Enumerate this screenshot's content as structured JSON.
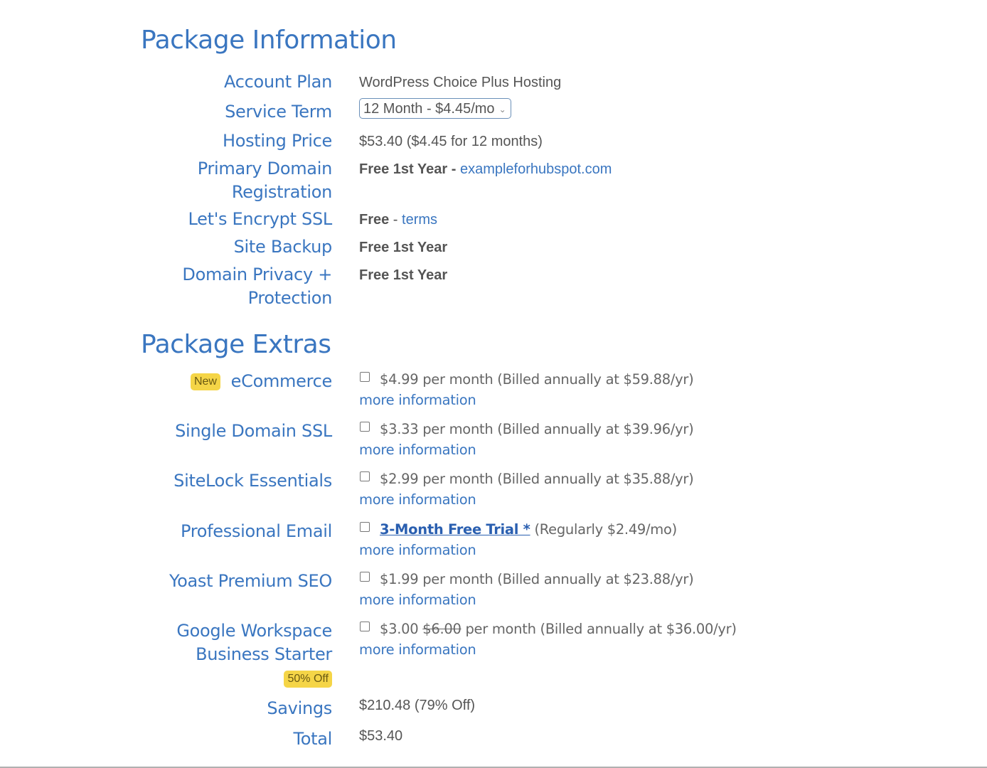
{
  "package_information": {
    "title": "Package Information",
    "rows": {
      "account_plan": {
        "label": "Account Plan",
        "value": "WordPress Choice Plus Hosting"
      },
      "service_term": {
        "label": "Service Term",
        "selected": "12 Month - $4.45/mo",
        "icon": "chevron-down-icon"
      },
      "hosting_price": {
        "label": "Hosting Price",
        "value": "$53.40 ($4.45 for 12 months)"
      },
      "primary_domain": {
        "label_line1": "Primary Domain",
        "label_line2": "Registration",
        "value_bold": "Free 1st Year -",
        "link": "exampleforhubspot.com"
      },
      "ssl": {
        "label": "Let's Encrypt SSL",
        "value_bold": "Free",
        "separator": " - ",
        "link": "terms"
      },
      "site_backup": {
        "label": "Site Backup",
        "value_bold": "Free 1st Year"
      },
      "domain_privacy": {
        "label_line1": "Domain Privacy +",
        "label_line2": "Protection",
        "value_bold": "Free 1st Year"
      }
    }
  },
  "package_extras": {
    "title": "Package Extras",
    "more_info_label": "more information",
    "items": [
      {
        "label": "eCommerce",
        "badge": "New",
        "checked": false,
        "price_text": "$4.99 per month (Billed annually at $59.88/yr)"
      },
      {
        "label": "Single Domain SSL",
        "checked": false,
        "price_text": "$3.33 per month (Billed annually at $39.96/yr)"
      },
      {
        "label": "SiteLock Essentials",
        "checked": false,
        "price_text": "$2.99 per month (Billed annually at $35.88/yr)"
      },
      {
        "label": "Professional Email",
        "checked": false,
        "trial_link": "3-Month Free Trial *",
        "price_text": " (Regularly $2.49/mo)"
      },
      {
        "label": "Yoast Premium SEO",
        "checked": false,
        "price_text": "$1.99 per month (Billed annually at $23.88/yr)"
      },
      {
        "label_line1": "Google Workspace",
        "label_line2": "Business Starter",
        "badge": "50% Off",
        "checked": false,
        "price_new": "$3.00",
        "price_old": "$6.00",
        "price_text": " per month (Billed annually at $36.00/yr)"
      }
    ]
  },
  "summary": {
    "savings": {
      "label": "Savings",
      "value": "$210.48 (79% Off)"
    },
    "total": {
      "label": "Total",
      "value": "$53.40"
    }
  },
  "colors": {
    "accent": "#3a76c0",
    "badge": "#f5d547",
    "text": "#555555"
  }
}
